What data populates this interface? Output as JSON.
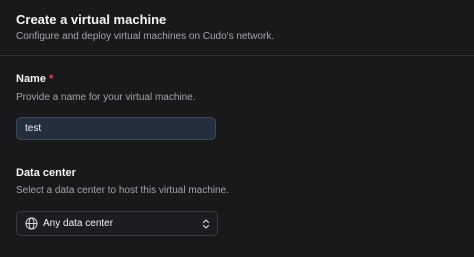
{
  "header": {
    "title": "Create a virtual machine",
    "subtitle": "Configure and deploy virtual machines on Cudo's network."
  },
  "name_field": {
    "label": "Name",
    "required_marker": "*",
    "help": "Provide a name for your virtual machine.",
    "value": "test"
  },
  "data_center_field": {
    "label": "Data center",
    "help": "Select a data center to host this virtual machine.",
    "selected": "Any data center",
    "icon": "globe-icon",
    "chevron_icon": "chevron-up-down-icon"
  },
  "colors": {
    "background": "#19191c",
    "input_background": "#232f3d",
    "required": "#e5484d"
  }
}
